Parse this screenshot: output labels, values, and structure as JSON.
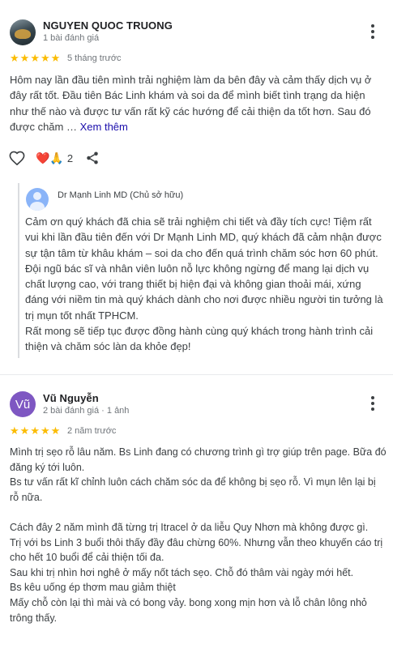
{
  "reviews": [
    {
      "author": "NGUYEN QUOC TRUONG",
      "author_meta": "1 bài đánh giá",
      "avatar_type": "photo",
      "rating": 5,
      "time": "5 tháng trước",
      "text": "Hôm nay lần đầu tiên mình trải nghiệm làm da bên đây và cảm thấy dịch vụ ở đây rất tốt. Đầu tiên Bác Linh khám và soi da để mình biết tình trạng da hiện như thế nào và được tư vấn rất kỹ các hướng để cải thiện da tốt hơn. Sau đó được chăm …",
      "more_label": "Xem thêm",
      "reactions": {
        "emoji": "❤️🙏",
        "count": "2"
      },
      "owner_reply": {
        "name": "Dr Mạnh Linh MD (Chủ sở hữu)",
        "paragraphs": [
          "Cảm ơn quý khách đã chia sẽ trải nghiệm chi tiết và đầy tích cực! Tiệm rất vui khi lần đầu tiên đến với Dr Mạnh Linh MD, quý khách đã cảm nhận được sự tận tâm từ khâu khám – soi da cho đến quá trình chăm sóc hơn 60 phút. Đội ngũ bác sĩ và nhân viên luôn nỗ lực không ngừng để mang lại dịch vụ chất lượng cao, với trang thiết bị hiện đại và không gian thoải mái, xứng đáng với niềm tin mà quý khách dành cho nơi được nhiều người tin tưởng là trị mụn tốt nhất TPHCM.",
          "Rất mong sẽ tiếp tục được đồng hành cùng quý khách trong hành trình cải thiện và chăm sóc làn da khỏe đẹp!"
        ]
      }
    },
    {
      "author": "Vũ Nguyễn",
      "author_meta": "2 bài đánh giá · 1 ảnh",
      "avatar_letter": "Vũ",
      "avatar_color": "#7e57c2",
      "rating": 5,
      "time": "2 năm trước",
      "paragraphs": [
        "Mình trị sẹo rỗ lâu năm. Bs Linh đang có chương trình gì trợ giúp trên page. Bữa đó đăng ký tới luôn.",
        "Bs tư vấn rất kĩ chỉnh luôn cách chăm sóc da để không bị sẹo rỗ. Vì mụn lên lại bị rỗ nữa.",
        "",
        "Cách đây 2 năm mình đã từng trị Itracel ở da liễu Quy Nhơn mà không được gì.",
        "Trị với bs Linh 3 buổi thôi thấy đầy đâu chừng 60%. Nhưng vẫn theo khuyến cáo trị cho hết 10 buổi để cải thiện tối đa.",
        "Sau khi trị nhìn hơi nghê ở mấy nốt tách sẹo. Chỗ đó thâm vài ngày mới hết.",
        "Bs kêu uống ép thơm mau giảm thiệt",
        "Mấy chỗ còn lại thì mài và có bong vảy. bong xong mịn hơn và lỗ chân lông nhỏ trông thấy."
      ]
    }
  ],
  "colors": {
    "star": "#fbbc04",
    "link": "#1a0dab",
    "avatar_purple": "#7e57c2",
    "owner_avatar": "#8ab4f8"
  }
}
